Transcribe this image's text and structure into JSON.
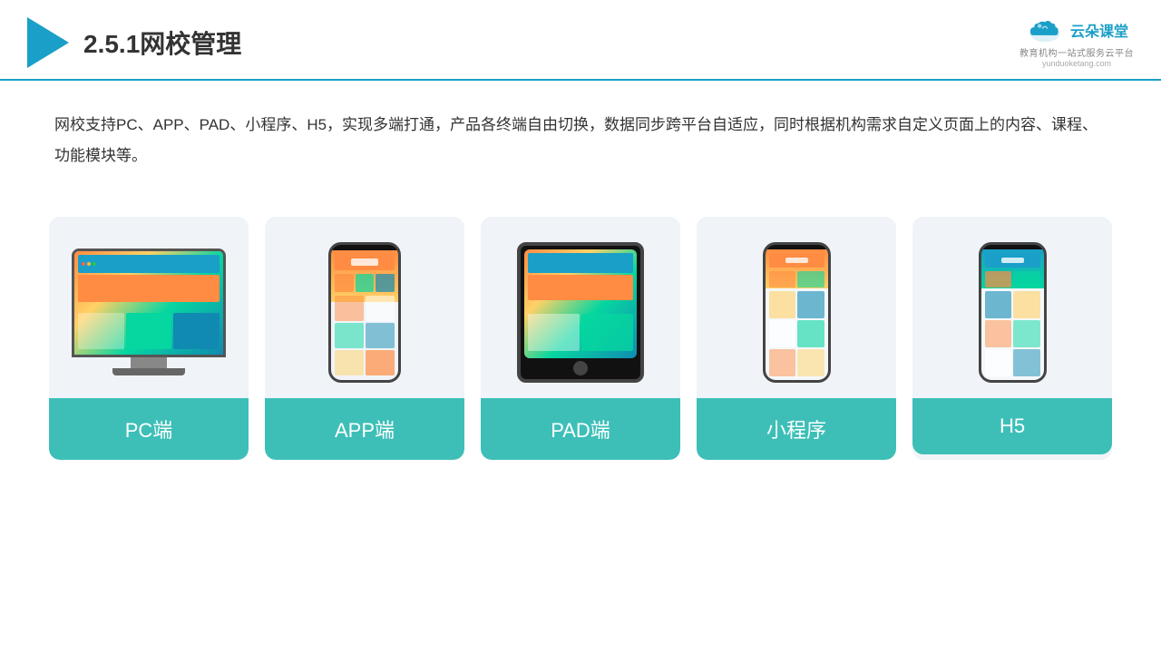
{
  "header": {
    "title": "2.5.1网校管理",
    "brand": {
      "name": "云朵课堂",
      "url": "yunduoketang.com",
      "tagline": "教育机构一站式服务云平台"
    }
  },
  "description": "网校支持PC、APP、PAD、小程序、H5，实现多端打通，产品各终端自由切换，数据同步跨平台自适应，同时根据机构需求自定义页面上的内容、课程、功能模块等。",
  "cards": [
    {
      "id": "pc",
      "label": "PC端"
    },
    {
      "id": "app",
      "label": "APP端"
    },
    {
      "id": "pad",
      "label": "PAD端"
    },
    {
      "id": "mini",
      "label": "小程序"
    },
    {
      "id": "h5",
      "label": "H5"
    }
  ],
  "colors": {
    "primary": "#1a9fc8",
    "card_label_bg": "#3dbfb8",
    "card_bg": "#f0f4f8"
  }
}
